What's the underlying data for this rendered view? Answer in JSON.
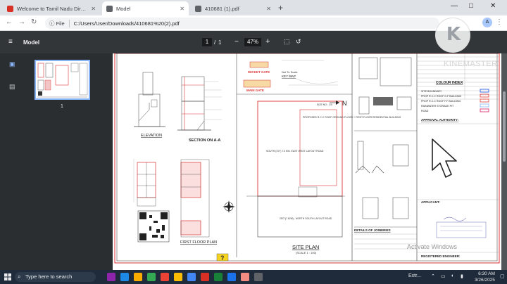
{
  "browser": {
    "tabs": [
      {
        "label": "Welcome to Tamil Nadu Directo",
        "active": false,
        "favicon_color": "#d93025"
      },
      {
        "label": "Model",
        "active": true,
        "favicon_color": "#5f6368"
      },
      {
        "label": "410681 (1).pdf",
        "active": false,
        "favicon_color": "#5f6368"
      }
    ],
    "new_tab": "+",
    "window_controls": {
      "minimize": "—",
      "maximize": "□",
      "close": "✕"
    },
    "address": {
      "chip": "File",
      "url": "C:/Users/User/Downloads/410681%20(2).pdf"
    },
    "profile_initial": "A"
  },
  "pdf_toolbar": {
    "menu": "≡",
    "title": "Model",
    "page_current": "1",
    "page_sep": "/",
    "page_total": "1",
    "zoom_minus": "−",
    "zoom": "47%",
    "zoom_plus": "+",
    "fit_icon": "⬚",
    "rotate_icon": "↺"
  },
  "sidebar": {
    "thumb_page_number": "1"
  },
  "drawing": {
    "labels": {
      "elevation": "ELEVATION",
      "section": "SECTION ON   A-A",
      "first_floor_plan": "FIRST FLOOR PLAN",
      "site_plan": "SITE PLAN",
      "scale": "(SCALE 1 : 100)",
      "key_map": "KEY MAP",
      "wicket_gate": "WICKET GATE",
      "main_gate": "MAIN GATE",
      "colour_index": "COLOUR INDEX",
      "approval_authority": "APPROVAL AUTHORITY:",
      "applicant": "APPLICANT:",
      "registered_engineer": "REGISTERED ENGINEER:",
      "details_joineries": "DETAILS OF JOINERIES",
      "north": "N",
      "proposed": "PROPOSED R.C.C ROOF GROUND FLOOR + FIRST FLOOR RESIDENTIAL BUILDING",
      "size_note": "SIZE NO : 1/0",
      "not_to_scale": "Not To Scale",
      "road_south": "SOUTH (3'0\") 7.0 EM- EAST WEST LAYOUT ROAD",
      "road_north": "25'0\"(7.62M) - NORTH SOUTH LAYOUT ROAD"
    },
    "colour_index_items": [
      {
        "label": "SITE  BOUNDARY",
        "color": "#1a4dd8"
      },
      {
        "label": "PROP R.C.C ROOF G.F BUILDING",
        "color": "#e53935"
      },
      {
        "label": "PROP R.C.C ROOF F.F BUILDING",
        "color": "#e53935"
      },
      {
        "label": "RAINWATER STORAGE PIT",
        "color": "#8ab4f8"
      },
      {
        "label": "ROAD",
        "color": "#d81b60"
      }
    ]
  },
  "overlay": {
    "watermark_letter": "K",
    "watermark_text": "KINEMASTER",
    "activate_windows": "Activate Windows"
  },
  "taskbar": {
    "search_placeholder": "Type here to search",
    "tray_text": "Extr...",
    "time": "6:30 AM",
    "date": "3/26/2025",
    "apps": [
      {
        "color": "#8e24aa"
      },
      {
        "color": "#1e88e5"
      },
      {
        "color": "#f9ab00"
      },
      {
        "color": "#34a853"
      },
      {
        "color": "#ea4335"
      },
      {
        "color": "#fbbc04"
      },
      {
        "color": "#4285f4"
      },
      {
        "color": "#d93025"
      },
      {
        "color": "#188038"
      },
      {
        "color": "#1a73e8"
      },
      {
        "color": "#f28b82"
      },
      {
        "color": "#5f6368"
      }
    ]
  }
}
